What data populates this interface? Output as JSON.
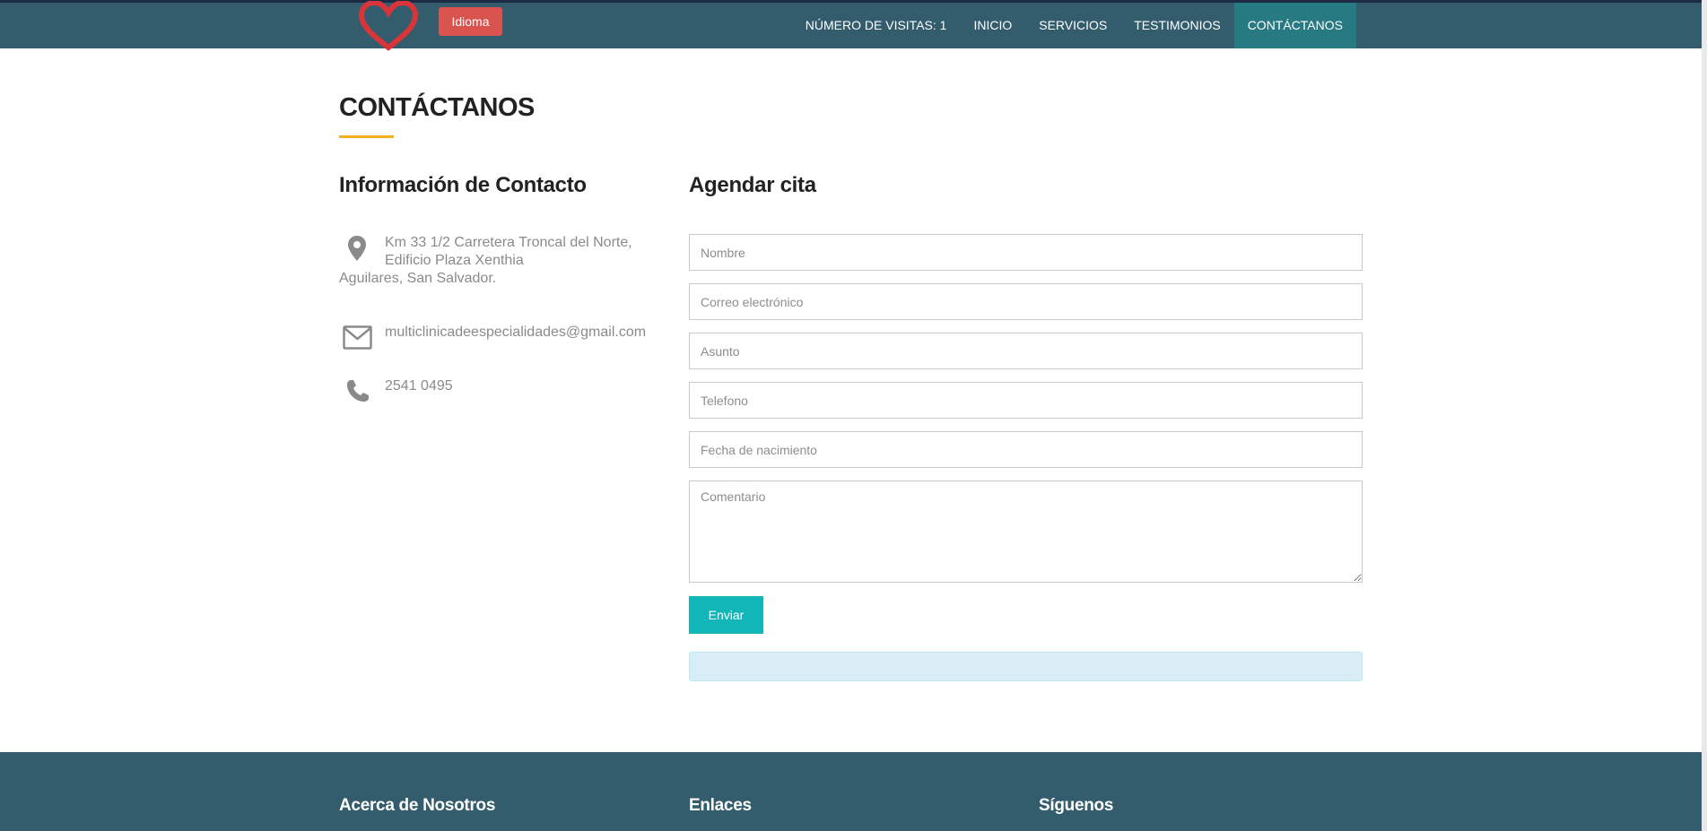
{
  "header": {
    "language_button": "Idioma",
    "nav": [
      {
        "label": "NÚMERO DE VISITAS: 1"
      },
      {
        "label": "INICIO"
      },
      {
        "label": "SERVICIOS"
      },
      {
        "label": "TESTIMONIOS"
      },
      {
        "label": "CONTÁCTANOS",
        "active": true
      }
    ]
  },
  "page": {
    "title": "CONTÁCTANOS",
    "accent_color": "#f2b01e"
  },
  "contact_info": {
    "heading": "Información de Contacto",
    "address_line1": "Km 33 1/2 Carretera Troncal del Norte,",
    "address_line2": "Edificio Plaza Xenthia",
    "address_line3": "Aguilares, San Salvador.",
    "email": "multiclinicadeespecialidades@gmail.com",
    "phone": "2541 0495",
    "icons": [
      "map-marker-icon",
      "envelope-icon",
      "phone-icon"
    ]
  },
  "appointment_form": {
    "heading": "Agendar cita",
    "name_placeholder": "Nombre",
    "email_placeholder": "Correo electrónico",
    "subject_placeholder": "Asunto",
    "phone_placeholder": "Telefono",
    "birthdate_placeholder": "Fecha de nacimiento",
    "comment_placeholder": "Comentario",
    "submit_label": "Enviar"
  },
  "footer": {
    "about_heading": "Acerca de Nosotros",
    "links_heading": "Enlaces",
    "follow_heading": "Síguenos"
  },
  "colors": {
    "navbar": "#335d6c",
    "nav_active": "#277a82",
    "language_button": "#d9534f",
    "submit_button": "#12b5b8",
    "alert": "#d9edf7"
  }
}
